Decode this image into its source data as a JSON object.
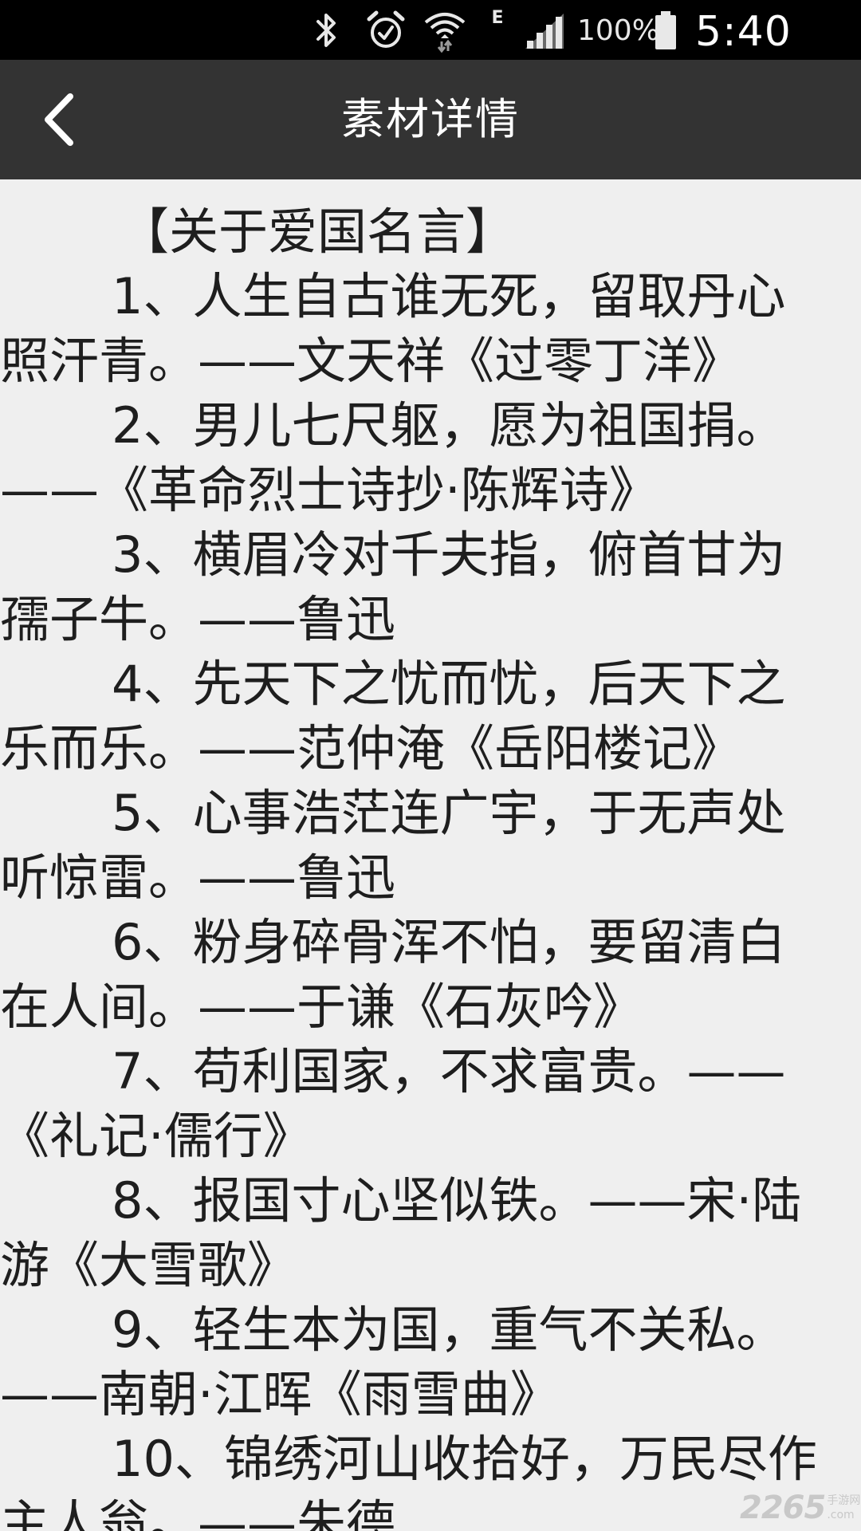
{
  "status_bar": {
    "battery_percent": "100%",
    "time": "5:40 PM",
    "network_type": "E",
    "icons": [
      "bluetooth-icon",
      "alarm-icon",
      "wifi-icon",
      "signal-icon",
      "battery-icon"
    ]
  },
  "toolbar": {
    "back_icon": "chevron-left-icon",
    "title": "素材详情"
  },
  "content": {
    "lines": [
      "【关于爱国名言】",
      "1、人生自古谁无死，留取丹心",
      "照汗青。——文天祥《过零丁洋》",
      "2、男儿七尺躯，愿为祖国捐。",
      "——《革命烈士诗抄·陈辉诗》",
      "3、横眉冷对千夫指，俯首甘为",
      "孺子牛。——鲁迅",
      "4、先天下之忧而忧，后天下之",
      "乐而乐。——范仲淹《岳阳楼记》",
      "5、心事浩茫连广宇，于无声处",
      "听惊雷。——鲁迅",
      "6、粉身碎骨浑不怕，要留清白",
      "在人间。——于谦《石灰吟》",
      "7、苟利国家，不求富贵。——",
      "《礼记·儒行》",
      "8、报国寸心坚似铁。——宋·陆",
      "游《大雪歌》",
      "9、轻生本为国，重气不关私。",
      "——南朝·江晖《雨雪曲》",
      "10、锦绣河山收拾好，万民尽作",
      "主人翁。——朱德"
    ]
  },
  "watermark": {
    "main": "2265",
    "side_top": "手游网",
    "side_bottom": ".com"
  }
}
